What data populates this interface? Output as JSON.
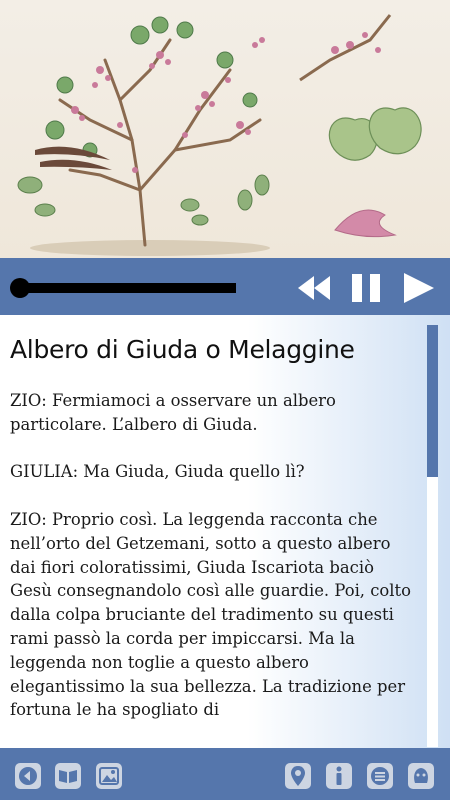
{
  "article": {
    "title": "Albero di Giuda o Melaggine",
    "paragraphs": [
      "ZIO: Fermiamoci a osservare un albero particolare. L’albero di Giuda.",
      "GIULIA: Ma Giuda, Giuda quello lì?",
      "ZIO: Proprio così. La leggenda racconta che nell’orto del Getzemani, sotto a questo albero dai fiori coloratissimi, Giuda Iscariota baciò Gesù consegnandolo così alle guardie. Poi, colto dalla colpa bruciante del tradimento su questi rami passò la corda per impiccarsi. Ma la leggenda non toglie a questo albero elegantissimo la sua bellezza. La tradizione per fortuna le ha spogliato di"
    ]
  },
  "player": {
    "progress": 0.02,
    "icons": [
      "rewind-icon",
      "pause-icon",
      "play-icon"
    ]
  },
  "bottom_bar": {
    "icons": [
      "back-icon",
      "book-icon",
      "gallery-icon",
      "map-pin-icon",
      "info-icon",
      "list-icon",
      "face-icon"
    ]
  },
  "colors": {
    "accent": "#5576ac",
    "icon_bg": "#cdd5e2",
    "icon_fg": "#5576ac",
    "scroll_track": "#ffffff",
    "text": "#1a1a1a"
  }
}
